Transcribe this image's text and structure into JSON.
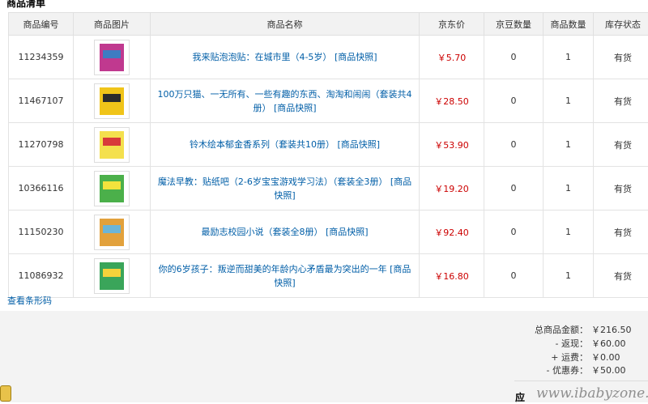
{
  "section_title": "商品清单",
  "columns": [
    "商品编号",
    "商品图片",
    "商品名称",
    "京东价",
    "京豆数量",
    "商品数量",
    "库存状态"
  ],
  "items": [
    {
      "id": "11234359",
      "name": "我来贴泡泡贴：在城市里（4-5岁）",
      "snapshot": "[商品快照]",
      "price": "￥5.70",
      "beans": "0",
      "qty": "1",
      "stock": "有货",
      "thumb_colors": [
        "#c0398f",
        "#3e7cc2"
      ]
    },
    {
      "id": "11467107",
      "name": "100万只猫、一无所有、一些有趣的东西、淘淘和闹闹（套装共4册）",
      "snapshot": "[商品快照]",
      "price": "￥28.50",
      "beans": "0",
      "qty": "1",
      "stock": "有货",
      "thumb_colors": [
        "#f0c419",
        "#2b2b2b"
      ]
    },
    {
      "id": "11270798",
      "name": "铃木绘本郁金香系列（套装共10册）",
      "snapshot": "[商品快照]",
      "price": "￥53.90",
      "beans": "0",
      "qty": "1",
      "stock": "有货",
      "thumb_colors": [
        "#f4e04d",
        "#d83a3a"
      ]
    },
    {
      "id": "10366116",
      "name": "魔法早教：贴纸吧（2-6岁宝宝游戏学习法）（套装全3册）",
      "snapshot": "[商品快照]",
      "price": "￥19.20",
      "beans": "0",
      "qty": "1",
      "stock": "有货",
      "thumb_colors": [
        "#4bb04a",
        "#f2e33d"
      ]
    },
    {
      "id": "11150230",
      "name": "最励志校园小说（套装全8册）",
      "snapshot": "[商品快照]",
      "price": "￥92.40",
      "beans": "0",
      "qty": "1",
      "stock": "有货",
      "thumb_colors": [
        "#e2a13c",
        "#6bb5d8"
      ]
    },
    {
      "id": "11086932",
      "name": "你的6岁孩子：叛逆而甜美的年龄内心矛盾最为突出的一年",
      "snapshot": "[商品快照]",
      "price": "￥16.80",
      "beans": "0",
      "qty": "1",
      "stock": "有货",
      "thumb_colors": [
        "#3aa55a",
        "#f5d23b"
      ]
    }
  ],
  "barcode_link": "查看条形码",
  "summary": {
    "total_label": "总商品金额：",
    "total_value": "￥216.50",
    "rebate_label": "- 返现：",
    "rebate_value": "￥60.00",
    "shipping_label": "+ 运费：",
    "shipping_value": "￥0.00",
    "discount_label": "- 优惠券：",
    "discount_value": "￥50.00",
    "payable_label": "应"
  },
  "watermark": "www.ibabyzone.cn",
  "colors": {
    "link": "#005ea7",
    "price": "#cc0000",
    "header_bg": "#f2f2f2",
    "summary_bg": "#f3f3f3"
  }
}
